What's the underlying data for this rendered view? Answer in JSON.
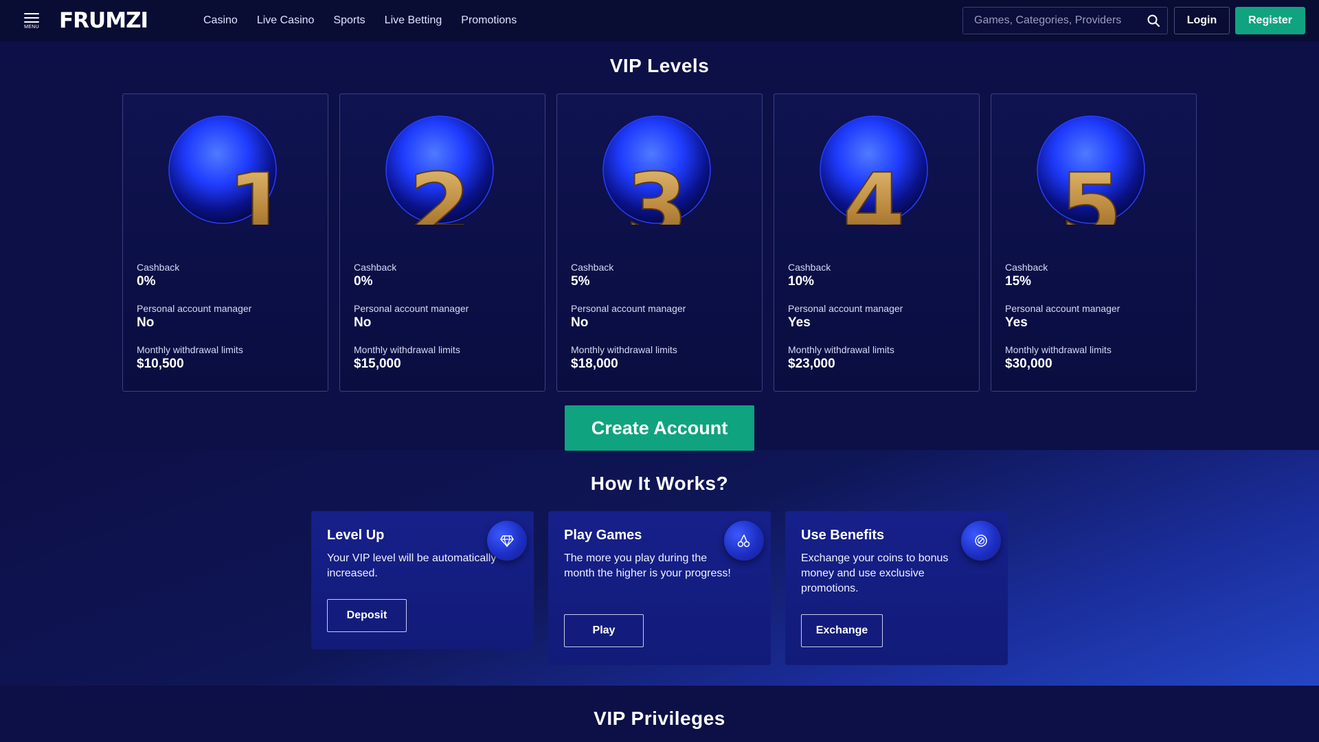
{
  "header": {
    "menu_label": "MENU",
    "logo_text": "FRUMZI",
    "nav": [
      "Casino",
      "Live Casino",
      "Sports",
      "Live Betting",
      "Promotions"
    ],
    "search_placeholder": "Games, Categories, Providers",
    "login_label": "Login",
    "register_label": "Register"
  },
  "vip": {
    "title": "VIP Levels",
    "cashback_label": "Cashback",
    "manager_label": "Personal account manager",
    "withdrawal_label": "Monthly withdrawal limits",
    "levels": [
      {
        "level": "1",
        "cashback": "0%",
        "manager": "No",
        "withdrawal": "$10,500"
      },
      {
        "level": "2",
        "cashback": "0%",
        "manager": "No",
        "withdrawal": "$15,000"
      },
      {
        "level": "3",
        "cashback": "5%",
        "manager": "No",
        "withdrawal": "$18,000"
      },
      {
        "level": "4",
        "cashback": "10%",
        "manager": "Yes",
        "withdrawal": "$23,000"
      },
      {
        "level": "5",
        "cashback": "15%",
        "manager": "Yes",
        "withdrawal": "$30,000"
      }
    ],
    "create_account_label": "Create Account"
  },
  "how": {
    "title": "How It Works?",
    "cards": [
      {
        "title": "Level Up",
        "text": "Your VIP level will be automatically increased.",
        "button": "Deposit",
        "icon": "diamond-icon"
      },
      {
        "title": "Play Games",
        "text": "The more you play during the month the higher is your progress!",
        "button": "Play",
        "icon": "cherries-icon"
      },
      {
        "title": "Use Benefits",
        "text": "Exchange your coins to bonus money and use exclusive promotions.",
        "button": "Exchange",
        "icon": "coin-exchange-icon"
      }
    ]
  },
  "privileges": {
    "title": "VIP Privileges"
  },
  "colors": {
    "background": "#0d0f47",
    "topbar": "#090c33",
    "accent_green": "#10a37f",
    "badge_blue": "#1f3cff",
    "numeral_gold": "#b8863b"
  }
}
